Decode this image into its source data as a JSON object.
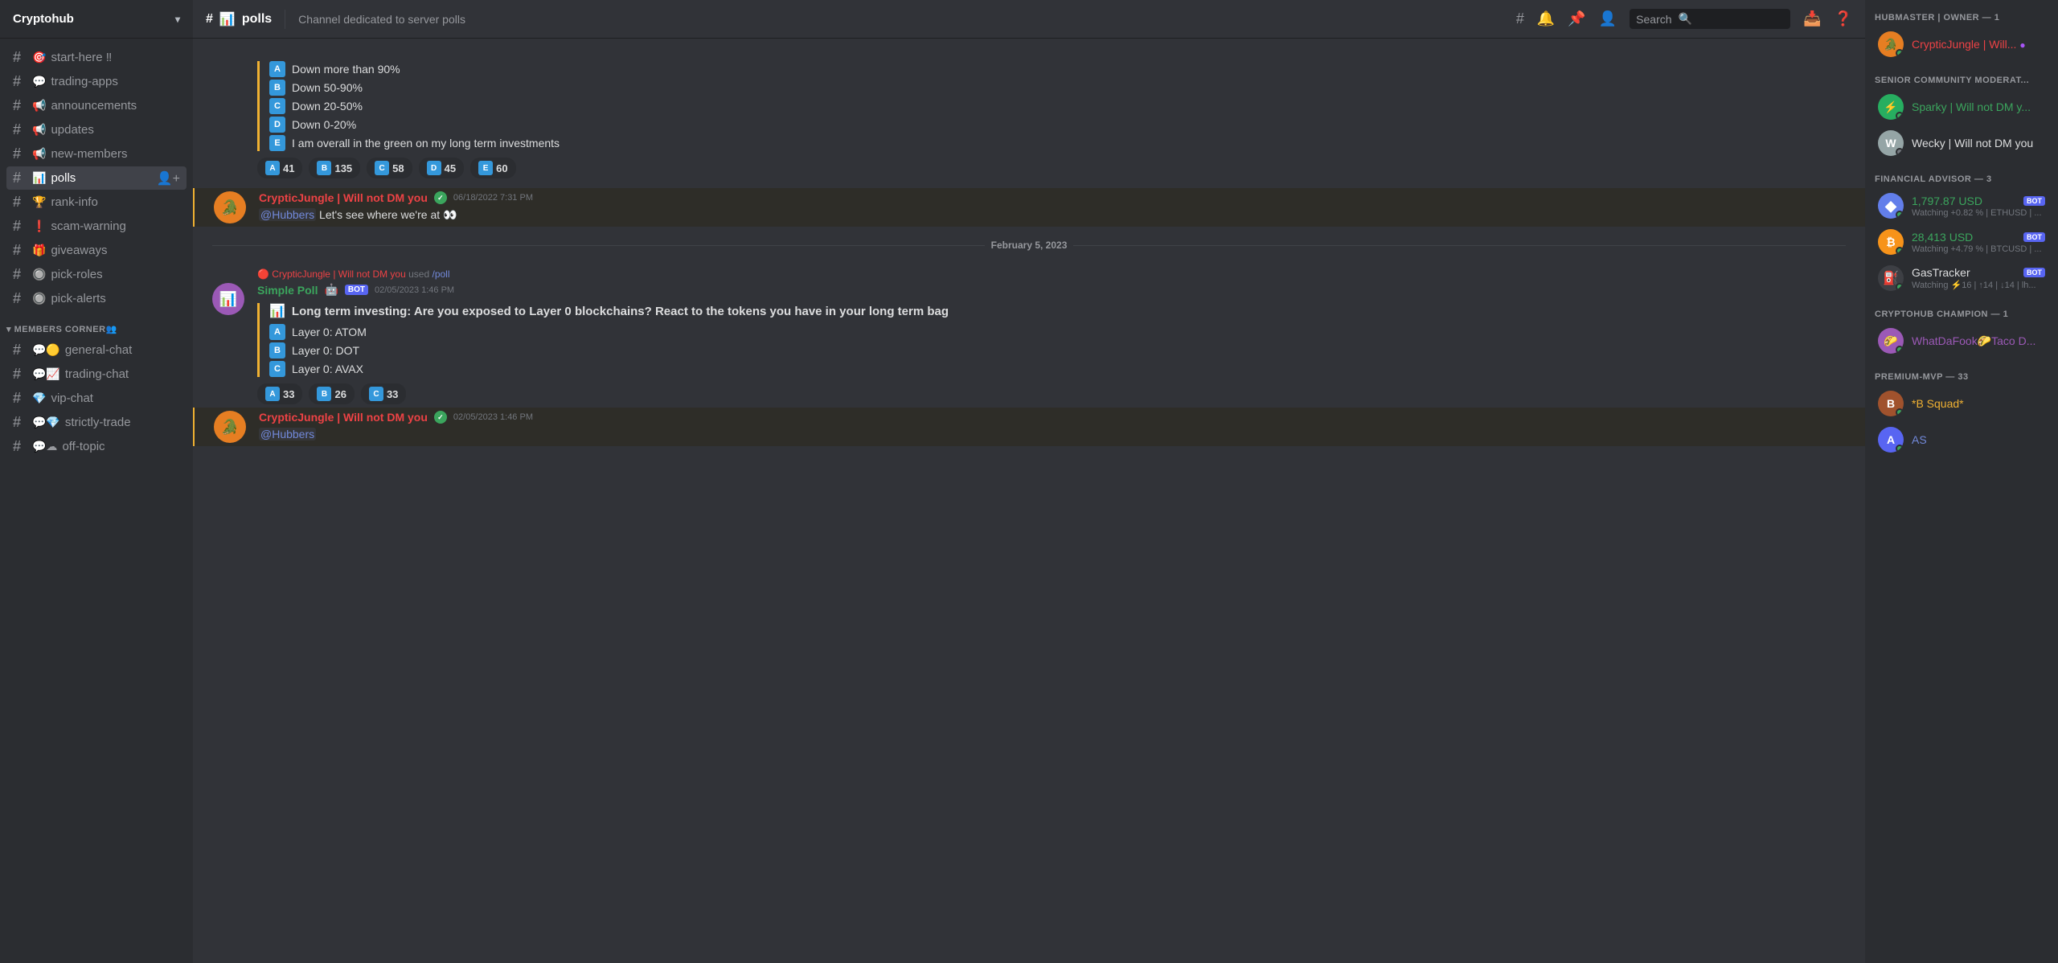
{
  "server": {
    "name": "Cryptohub",
    "icon": "🔐"
  },
  "topbar": {
    "channel_icon": "📊",
    "channel_name": "polls",
    "description": "Channel dedicated to server polls",
    "search_placeholder": "Search"
  },
  "sidebar": {
    "channels": [
      {
        "id": "start-here",
        "name": "start-here",
        "icon": "🎯",
        "suffix": "‼",
        "emoji_icon": true
      },
      {
        "id": "trading-apps",
        "name": "trading-apps",
        "icon": "💬",
        "emoji_icon": true
      },
      {
        "id": "announcements",
        "name": "announcements",
        "icon": "📢",
        "emoji_icon": true
      },
      {
        "id": "updates",
        "name": "updates",
        "icon": "📢",
        "emoji_icon": true
      },
      {
        "id": "new-members",
        "name": "new-members",
        "icon": "📢",
        "emoji_icon": true
      },
      {
        "id": "polls",
        "name": "polls",
        "icon": "📊",
        "emoji_icon": true,
        "active": true
      },
      {
        "id": "rank-info",
        "name": "rank-info",
        "icon": "🏆",
        "emoji_icon": true
      },
      {
        "id": "scam-warning",
        "name": "scam-warning",
        "icon": "❗",
        "emoji_icon": true
      },
      {
        "id": "giveaways",
        "name": "giveaways",
        "icon": "🎁",
        "emoji_icon": true
      },
      {
        "id": "pick-roles",
        "name": "pick-roles",
        "icon": "🔘",
        "emoji_icon": true
      },
      {
        "id": "pick-alerts",
        "name": "pick-alerts",
        "icon": "🔘",
        "emoji_icon": true
      }
    ],
    "members_corner_label": "MEMBERS CORNER👥",
    "members_channels": [
      {
        "id": "general-chat",
        "name": "general-chat",
        "icon": "💬🟡",
        "emoji_icon": true
      },
      {
        "id": "trading-chat",
        "name": "trading-chat",
        "icon": "💬📈",
        "emoji_icon": true
      },
      {
        "id": "vip-chat",
        "name": "vip-chat",
        "icon": "💎",
        "emoji_icon": true
      },
      {
        "id": "strictly-trade",
        "name": "strictly-trade",
        "icon": "💬💎",
        "emoji_icon": true
      },
      {
        "id": "off-topic",
        "name": "off-topic",
        "icon": "💬☁",
        "emoji_icon": true
      }
    ]
  },
  "messages": [
    {
      "id": "poll1",
      "type": "poll_results",
      "options": [
        {
          "letter": "A",
          "text": "Down more than 90%"
        },
        {
          "letter": "B",
          "text": "Down 50-90%"
        },
        {
          "letter": "C",
          "text": "Down 20-50%"
        },
        {
          "letter": "D",
          "text": "Down 0-20%"
        },
        {
          "letter": "E",
          "text": "I am overall in the green on my long term investments"
        }
      ],
      "votes": [
        {
          "letter": "A",
          "count": "41"
        },
        {
          "letter": "B",
          "count": "135"
        },
        {
          "letter": "C",
          "count": "58"
        },
        {
          "letter": "D",
          "count": "45"
        },
        {
          "letter": "E",
          "count": "60"
        }
      ]
    },
    {
      "id": "msg1",
      "type": "message",
      "author": "CrypticJungle | Will not DM you",
      "author_color": "red",
      "verified": true,
      "timestamp": "06/18/2022 7:31 PM",
      "avatar_color": "orange",
      "avatar_emoji": "🐊",
      "text": "@Hubbers Let's see where we're at 👀",
      "mention": "@Hubbers",
      "highlighted": true
    },
    {
      "id": "date1",
      "type": "date_divider",
      "date": "February 5, 2023"
    },
    {
      "id": "slash1",
      "type": "slash_used",
      "author": "CrypticJungle | Will not DM you",
      "command": "/poll"
    },
    {
      "id": "poll2",
      "type": "poll_message",
      "bot_author": "Simple Poll",
      "bot_timestamp": "02/05/2023 1:46 PM",
      "avatar_color": "purple",
      "avatar_emoji": "📊",
      "title": "Long term investing: Are you exposed to Layer 0 blockchains? React to the tokens you have in your long term bag",
      "options": [
        {
          "letter": "A",
          "text": "Layer 0: ATOM"
        },
        {
          "letter": "B",
          "text": "Layer 0: DOT"
        },
        {
          "letter": "C",
          "text": "Layer 0: AVAX"
        }
      ],
      "votes": [
        {
          "letter": "A",
          "count": "33"
        },
        {
          "letter": "B",
          "count": "26"
        },
        {
          "letter": "C",
          "count": "33"
        }
      ]
    },
    {
      "id": "msg2",
      "type": "message",
      "author": "CrypticJungle | Will not DM you",
      "author_color": "red",
      "verified": true,
      "timestamp": "02/05/2023 1:46 PM",
      "avatar_color": "orange",
      "avatar_emoji": "🐊",
      "text": "@Hubbers",
      "mention": "@Hubbers",
      "highlighted": true
    }
  ],
  "right_sidebar": {
    "sections": [
      {
        "label": "HUBMASTER | OWNER — 1",
        "members": [
          {
            "name": "CrypticJungle | Will...",
            "name_color": "red",
            "status": "online",
            "avatar_bg": "#e67e22",
            "avatar_emoji": "🐊",
            "has_purple_dot": true
          }
        ]
      },
      {
        "label": "SENIOR COMMUNITY MODERAT...",
        "members": [
          {
            "name": "Sparky | Will not DM y...",
            "name_color": "green",
            "status": "online",
            "avatar_bg": "#2ecc71",
            "avatar_emoji": "⚡"
          },
          {
            "name": "Wecky | Will not DM you",
            "name_color": "default",
            "status": "offline",
            "avatar_bg": "#95a5a6",
            "avatar_emoji": "W"
          }
        ]
      },
      {
        "label": "FINANCIAL ADVISOR — 3",
        "members": [
          {
            "name": "1,797.87 USD",
            "name_color": "green",
            "subtext": "Watching +0.82 % | ETHUSD | ...",
            "is_bot": true,
            "avatar_bg": "#627eea",
            "avatar_emoji": "◆",
            "status": "online"
          },
          {
            "name": "28,413 USD",
            "name_color": "green",
            "subtext": "Watching +4.79 % | BTCUSD | ...",
            "is_bot": true,
            "avatar_bg": "#f7931a",
            "avatar_emoji": "₿",
            "status": "online"
          },
          {
            "name": "GasTracker",
            "name_color": "default",
            "subtext": "Watching ⚡16 | ⬆14 | ⬇14 | lh...",
            "is_bot": true,
            "avatar_bg": "#2b2d31",
            "avatar_emoji": "⛽",
            "status": "online"
          }
        ]
      },
      {
        "label": "CRYPTOHUB CHAMPION — 1",
        "members": [
          {
            "name": "WhatDaFook🌮Taco D...",
            "name_color": "purple",
            "status": "online",
            "avatar_bg": "#9b59b6",
            "avatar_emoji": "🌮"
          }
        ]
      },
      {
        "label": "PREMIUM-MVP — 33",
        "members": [
          {
            "name": "*B Squad*",
            "name_color": "gold",
            "status": "online",
            "avatar_bg": "#f0b132",
            "avatar_emoji": "B"
          },
          {
            "name": "AS",
            "name_color": "blue",
            "status": "online",
            "avatar_bg": "#5865f2",
            "avatar_emoji": "A"
          }
        ]
      }
    ]
  }
}
